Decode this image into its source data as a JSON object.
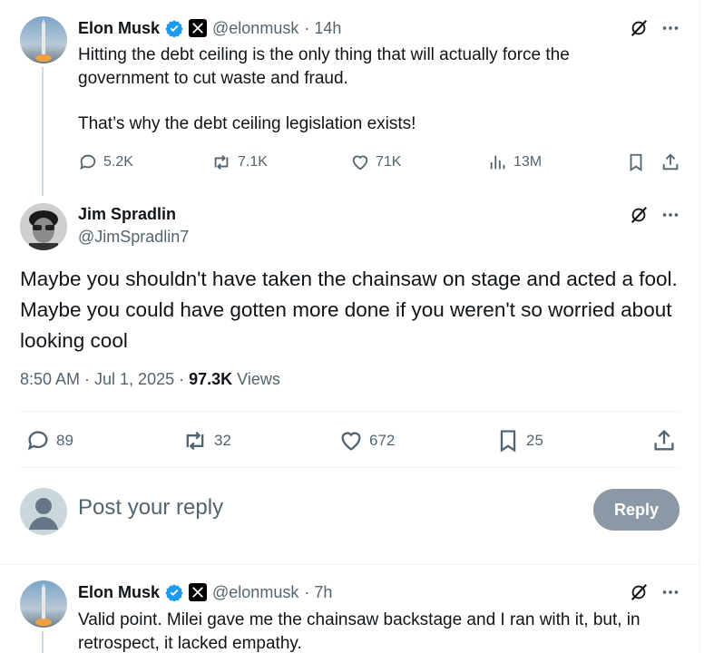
{
  "tweet1": {
    "author_name": "Elon Musk",
    "handle": "@elonmusk",
    "time": "· 14h",
    "text_line1": "Hitting the debt ceiling is the only thing that will actually force the",
    "text_line2": "government to cut waste and fraud.",
    "text_line3": "That’s why the debt ceiling legislation exists!",
    "replies": "5.2K",
    "reposts": "7.1K",
    "likes": "71K",
    "views": "13M"
  },
  "main_tweet": {
    "author_name": "Jim Spradlin",
    "handle": "@JimSpradlin7",
    "text_line1": "Maybe you shouldn't have taken the chainsaw on stage and acted a fool.",
    "text_line2": "Maybe you could have gotten more done if you weren't so worried about",
    "text_line3": "looking cool",
    "timestamp": "8:50 AM · Jul 1, 2025 ·",
    "view_count": "97.3K",
    "views_label": "Views",
    "replies": "89",
    "reposts": "32",
    "likes": "672",
    "bookmarks": "25"
  },
  "reply_box": {
    "placeholder": "Post your reply",
    "button_label": "Reply"
  },
  "tweet3": {
    "author_name": "Elon Musk",
    "handle": "@elonmusk",
    "time": "· 7h",
    "text_line1": "Valid point. Milei gave me the chainsaw backstage and I ran with it, but, in",
    "text_line2": "retrospect, it lacked empathy."
  },
  "colors": {
    "verified": "#1d9bf0",
    "secondary_text": "#536471",
    "reply_button": "#8b98a5"
  },
  "icons": [
    "verified-badge-icon",
    "x-affiliate-icon",
    "grok-icon",
    "more-icon",
    "reply-icon",
    "repost-icon",
    "like-icon",
    "views-icon",
    "bookmark-icon",
    "share-icon"
  ]
}
